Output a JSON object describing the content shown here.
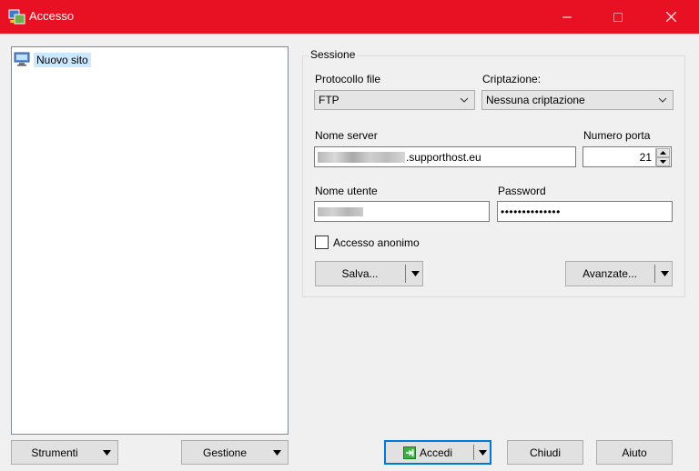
{
  "window": {
    "title": "Accesso",
    "icons": {
      "app": "winscp-icon",
      "minimize": "minimize-icon",
      "maximize": "maximize-icon",
      "close": "close-icon"
    }
  },
  "site_tree": {
    "items": [
      {
        "label": "Nuovo sito",
        "icon": "computer-monitor-icon",
        "selected": true
      }
    ]
  },
  "session": {
    "group_label": "Sessione",
    "protocol": {
      "label": "Protocollo file",
      "value": "FTP"
    },
    "encryption": {
      "label": "Criptazione:",
      "value": "Nessuna criptazione"
    },
    "server": {
      "label": "Nome server",
      "value_suffix": ".supporthost.eu"
    },
    "port": {
      "label": "Numero porta",
      "value": "21"
    },
    "username": {
      "label": "Nome utente"
    },
    "password": {
      "label": "Password",
      "masked_value": "••••••••••••••"
    },
    "anonymous": {
      "label": "Accesso anonimo",
      "checked": false
    },
    "save_label": "Salva...",
    "advanced_label": "Avanzate..."
  },
  "bottom": {
    "tools_label": "Strumenti",
    "manage_label": "Gestione",
    "login_label": "Accedi",
    "close_label": "Chiudi",
    "help_label": "Aiuto"
  },
  "colors": {
    "titlebar": "#e81123",
    "selection": "#cce8ff",
    "default_button_border": "#0078d7"
  }
}
